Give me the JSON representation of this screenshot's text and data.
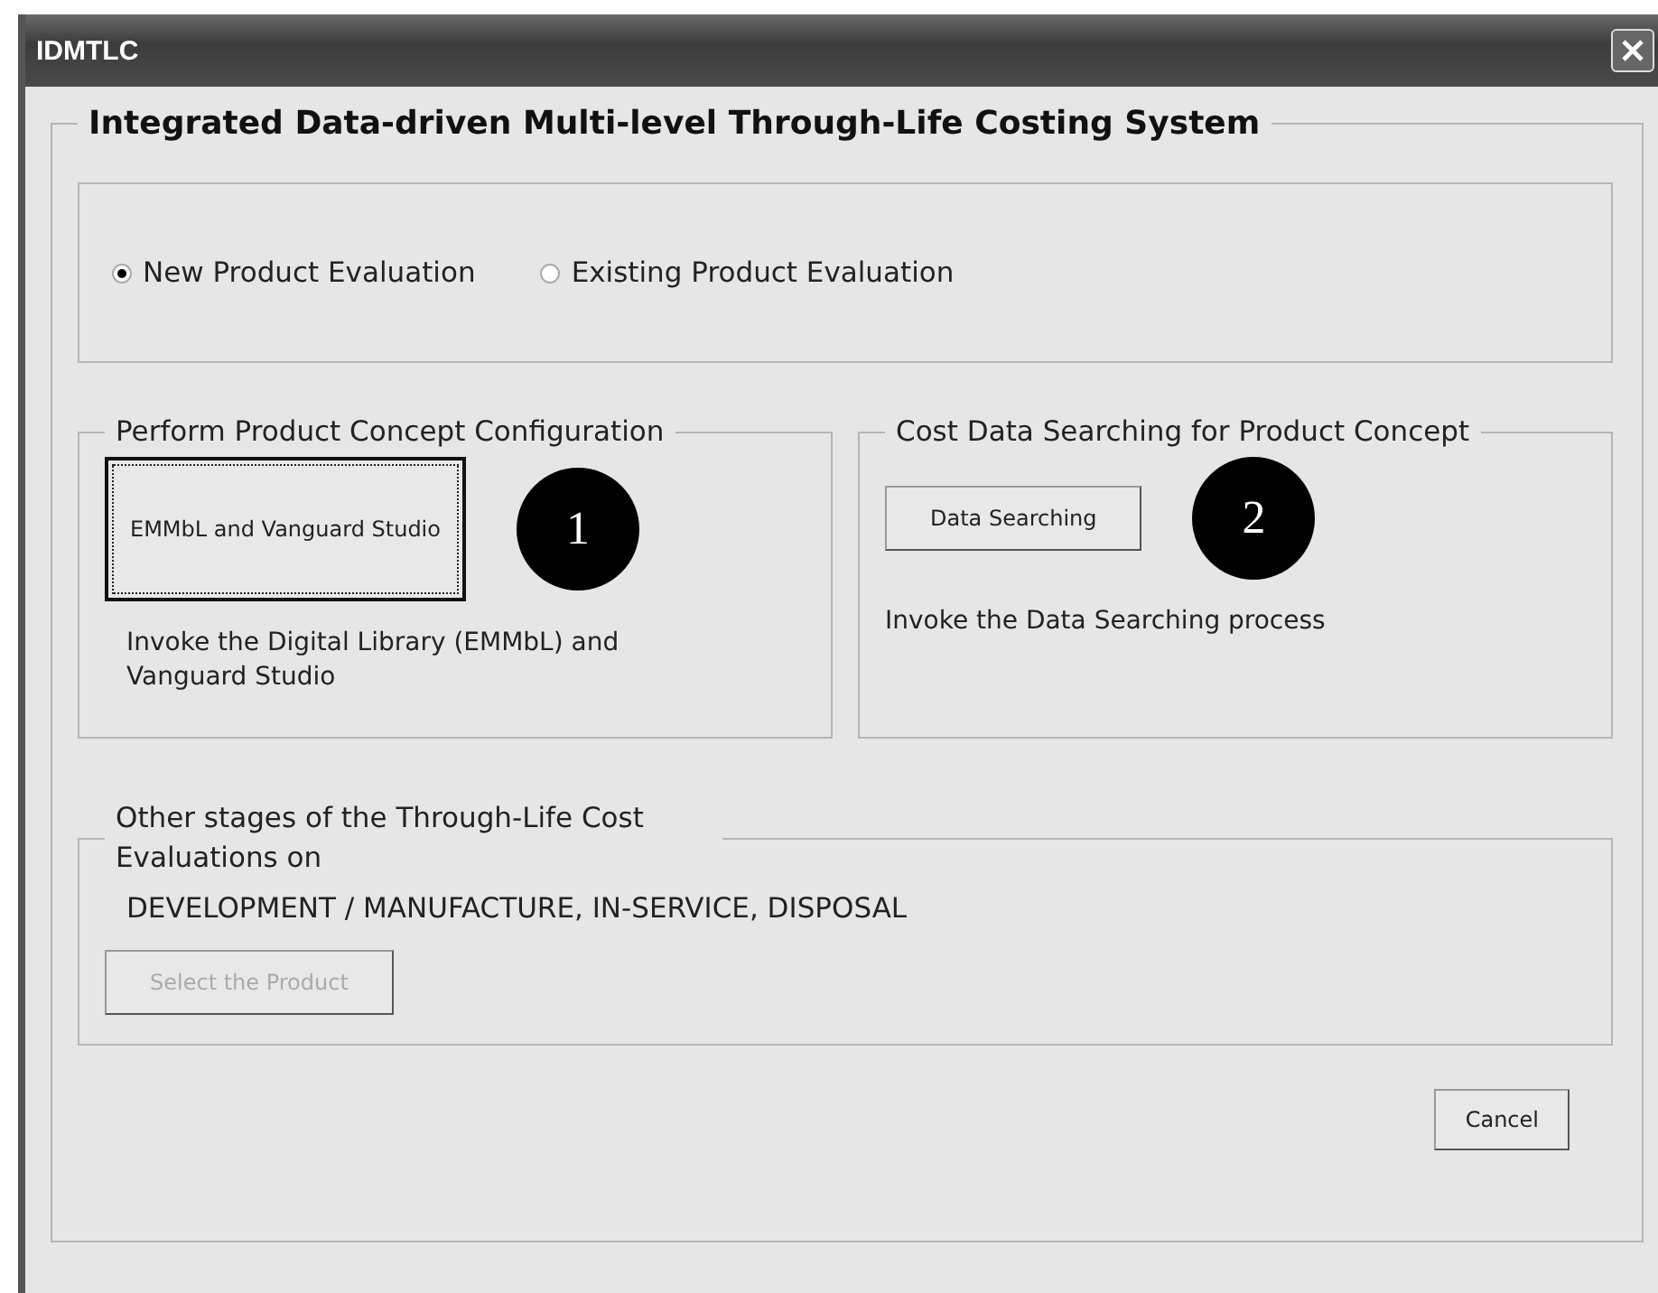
{
  "window": {
    "title": "IDMTLC"
  },
  "frame": {
    "title": "Integrated Data-driven Multi-level Through-Life Costing System"
  },
  "evaluation_options": [
    {
      "label": "New Product Evaluation",
      "selected": true
    },
    {
      "label": "Existing Product Evaluation",
      "selected": false
    }
  ],
  "sections": [
    {
      "title": "Perform Product Concept Configuration",
      "button": {
        "label": "EMMbL and Vanguard Studio",
        "focused": true,
        "disabled": false
      },
      "badge": "1",
      "description": "Invoke the Digital Library (EMMbL) and Vanguard Studio"
    },
    {
      "title": "Cost Data Searching for Product Concept",
      "button": {
        "label": "Data Searching",
        "focused": false,
        "disabled": false
      },
      "badge": "2",
      "description": "Invoke the Data Searching process"
    }
  ],
  "other_stages": {
    "title": "Other stages of the Through-Life Cost Evaluations on",
    "subtitle": "DEVELOPMENT / MANUFACTURE, IN-SERVICE, DISPOSAL",
    "button": {
      "label": "Select the Product",
      "disabled": true
    }
  },
  "buttons": [
    "Cancel"
  ]
}
